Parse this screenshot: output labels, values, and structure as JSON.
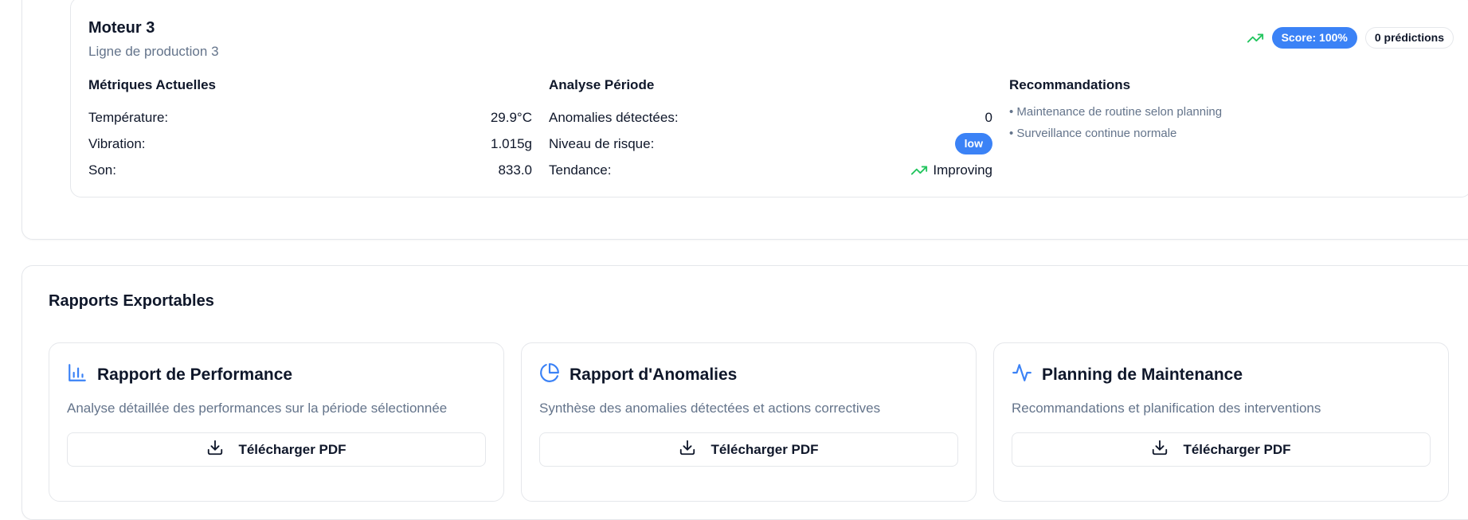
{
  "machine": {
    "title": "Moteur 3",
    "subtitle": "Ligne de production 3",
    "score_badge": "Score: 100%",
    "predictions_badge": "0 prédictions",
    "trend_icon": "trending-up-icon",
    "trend_color": "#22c55e",
    "metrics": {
      "title": "Métriques Actuelles",
      "rows": [
        {
          "label": "Température:",
          "value": "29.9°C"
        },
        {
          "label": "Vibration:",
          "value": "1.015g"
        },
        {
          "label": "Son:",
          "value": "833.0"
        }
      ]
    },
    "analysis": {
      "title": "Analyse Période",
      "anomalies_label": "Anomalies détectées:",
      "anomalies_value": "0",
      "risk_label": "Niveau de risque:",
      "risk_value": "low",
      "trend_label": "Tendance:",
      "trend_value": "Improving"
    },
    "recommendations": {
      "title": "Recommandations",
      "items": [
        "• Maintenance de routine selon planning",
        "• Surveillance continue normale"
      ]
    }
  },
  "reports": {
    "title": "Rapports Exportables",
    "accent_color": "#3b82f6",
    "cards": [
      {
        "title": "Rapport de Performance",
        "description": "Analyse détaillée des performances sur la période sélectionnée",
        "button": "Télécharger PDF",
        "icon": "bar-chart-icon"
      },
      {
        "title": "Rapport d'Anomalies",
        "description": "Synthèse des anomalies détectées et actions correctives",
        "button": "Télécharger PDF",
        "icon": "pie-chart-icon"
      },
      {
        "title": "Planning de Maintenance",
        "description": "Recommandations et planification des interventions",
        "button": "Télécharger PDF",
        "icon": "activity-icon"
      }
    ]
  }
}
